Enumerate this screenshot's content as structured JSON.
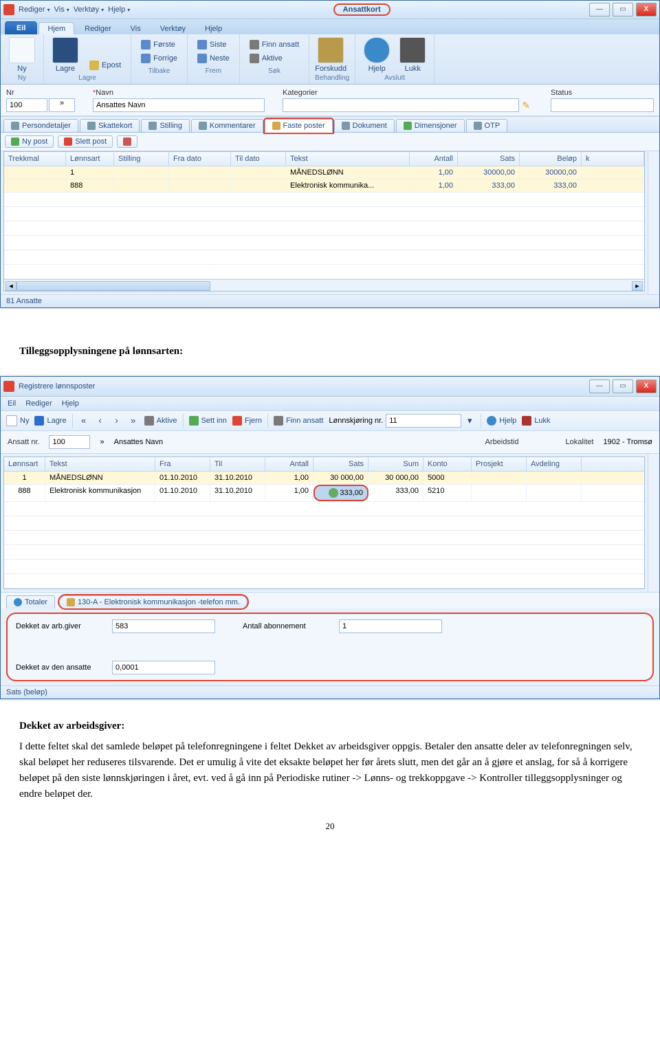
{
  "win1": {
    "title": "Ansattkort",
    "menus": [
      "Rediger",
      "Vis",
      "Verktøy",
      "Hjelp"
    ],
    "ribbon": {
      "tabs": {
        "file": "Eil",
        "home": "Hjem",
        "rediger": "Rediger",
        "vis": "Vis",
        "verktoy": "Verktøy",
        "hjelp": "Hjelp"
      },
      "groups": {
        "ny": "Ny",
        "lagre": "Lagre",
        "tilbake": "Tilbake",
        "frem": "Frem",
        "sok": "Søk",
        "behandling": "Behandling",
        "avslutt": "Avslutt"
      },
      "btns": {
        "ny": "Ny",
        "lagre": "Lagre",
        "epost": "Epost",
        "forste": "Første",
        "forrige": "Forrige",
        "siste": "Siste",
        "neste": "Neste",
        "finn": "Finn ansatt",
        "aktive": "Aktive",
        "forskudd": "Forskudd",
        "hjelp": "Hjelp",
        "lukk": "Lukk"
      }
    },
    "form": {
      "nr_lbl": "Nr",
      "nr_val": "100",
      "navn_lbl": "Navn",
      "navn_val": "Ansattes Navn",
      "kat_lbl": "Kategorier",
      "status_lbl": "Status"
    },
    "tabs": [
      "Persondetaljer",
      "Skattekort",
      "Stilling",
      "Kommentarer",
      "Faste poster",
      "Dokument",
      "Dimensjoner",
      "OTP"
    ],
    "toolbar": {
      "ny": "Ny post",
      "slett": "Slett post"
    },
    "cols": [
      "Trekkmal",
      "Lønnsart",
      "Stilling",
      "Fra dato",
      "Til dato",
      "Tekst",
      "Antall",
      "Sats",
      "Beløp",
      "k"
    ],
    "rows": [
      {
        "lonnsart": "1",
        "tekst": "MÅNEDSLØNN",
        "antall": "1,00",
        "sats": "30000,00",
        "belop": "30000,00"
      },
      {
        "lonnsart": "888",
        "tekst": "Elektronisk kommunika...",
        "antall": "1,00",
        "sats": "333,00",
        "belop": "333,00"
      }
    ],
    "status": "81 Ansatte"
  },
  "heading1": "Tilleggsopplysningene på lønnsarten:",
  "win2": {
    "title": "Registrere lønnsposter",
    "menus": [
      "Eil",
      "Rediger",
      "Hjelp"
    ],
    "tb": {
      "ny": "Ny",
      "lagre": "Lagre",
      "aktive": "Aktive",
      "settinn": "Sett inn",
      "fjern": "Fjern",
      "finn": "Finn ansatt",
      "lonnkj_lbl": "Lønnskjøring nr.",
      "lonnkj_val": "11",
      "hjelp": "Hjelp",
      "lukk": "Lukk"
    },
    "hdr": {
      "ansatt_lbl": "Ansatt nr.",
      "ansatt_val": "100",
      "navn": "Ansattes Navn",
      "arb_lbl": "Arbeidstid",
      "lok_lbl": "Lokalitet",
      "lok_val": "1902 - Tromsø"
    },
    "cols": [
      "Lønnsart",
      "Tekst",
      "Fra",
      "Til",
      "Antall",
      "Sats",
      "Sum",
      "Konto",
      "Prosjekt",
      "Avdeling"
    ],
    "rows": [
      {
        "la": "1",
        "tekst": "MÅNEDSLØNN",
        "fra": "01.10.2010",
        "til": "31.10.2010",
        "antall": "1,00",
        "sats": "30 000,00",
        "sum": "30 000,00",
        "konto": "5000"
      },
      {
        "la": "888",
        "tekst": "Elektronisk kommunikasjon",
        "fra": "01.10.2010",
        "til": "31.10.2010",
        "antall": "1,00",
        "sats": "333,00",
        "sum": "333,00",
        "konto": "5210"
      }
    ],
    "sect": {
      "totaler": "Totaler",
      "kode": "130-A - Elektronisk kommunikasjon -telefon mm."
    },
    "fields": {
      "dekket_arb_lbl": "Dekket av arb.giver",
      "dekket_arb_val": "583",
      "antall_ab_lbl": "Antall abonnement",
      "antall_ab_val": "1",
      "dekket_ans_lbl": "Dekket av den ansatte",
      "dekket_ans_val": "0,0001"
    },
    "status": "Sats (beløp)"
  },
  "doc": {
    "h2": "Dekket av arbeidsgiver:",
    "p1": "I dette feltet skal det samlede beløpet på telefonregningene i feltet Dekket av arbeidsgiver oppgis. Betaler den ansatte deler av telefonregningen selv, skal beløpet her reduseres tilsvarende. Det er umulig å vite det eksakte beløpet her før årets slutt, men det går an å gjøre et anslag, for så å korrigere beløpet på den siste lønnskjøringen i året, evt. ved å gå inn på Periodiske rutiner -> Lønns- og trekkoppgave -> Kontroller tilleggsopplysninger og endre beløpet der.",
    "pg": "20"
  }
}
